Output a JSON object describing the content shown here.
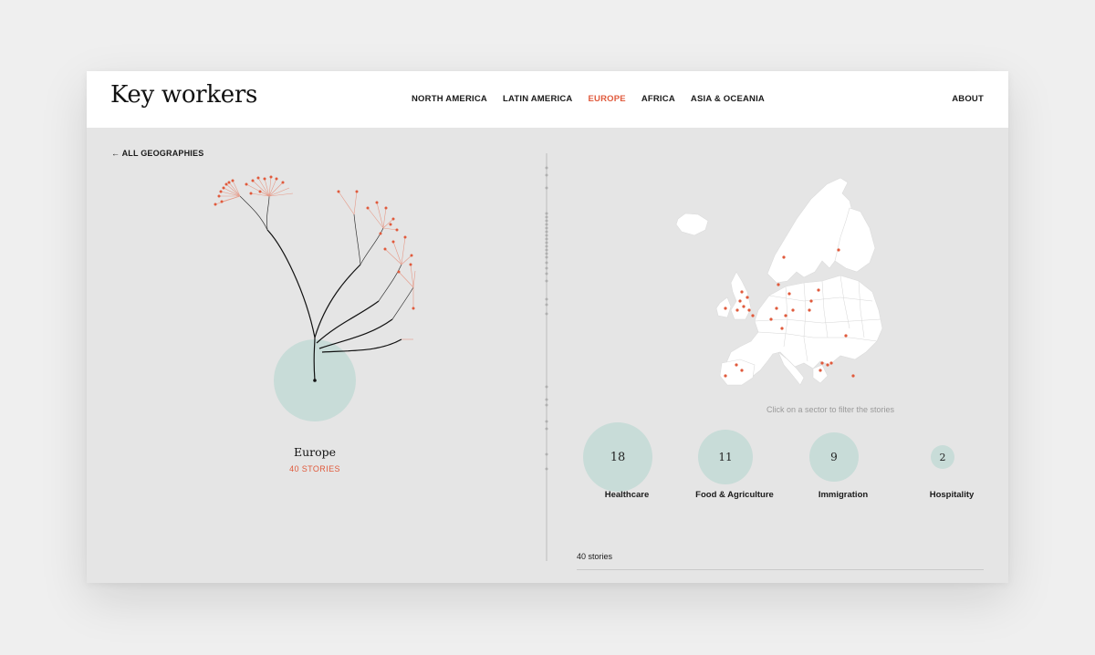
{
  "app": {
    "title": "Key workers"
  },
  "nav": {
    "items": [
      {
        "label": "NORTH AMERICA",
        "active": false
      },
      {
        "label": "LATIN AMERICA",
        "active": false
      },
      {
        "label": "EUROPE",
        "active": true
      },
      {
        "label": "AFRICA",
        "active": false
      },
      {
        "label": "ASIA & OCEANIA",
        "active": false
      }
    ],
    "about": "ABOUT"
  },
  "back": {
    "label": "← ALL GEOGRAPHIES"
  },
  "region": {
    "name": "Europe",
    "count_label": "40 STORIES"
  },
  "map": {
    "hint": "Click on a sector to filter the stories"
  },
  "sectors": [
    {
      "label": "Healthcare",
      "count": "18"
    },
    {
      "label": "Food & Agriculture",
      "count": "11"
    },
    {
      "label": "Immigration",
      "count": "9"
    },
    {
      "label": "Hospitality",
      "count": "2"
    }
  ],
  "stories": {
    "count_label": "40 stories"
  },
  "colors": {
    "accent": "#e05a3c",
    "bubble": "#c8dcd8",
    "background": "#e5e5e5"
  }
}
